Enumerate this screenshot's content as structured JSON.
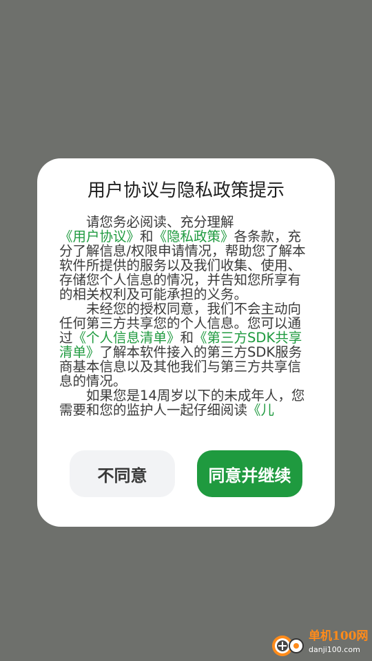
{
  "dialog": {
    "title": "用户协议与隐私政策提示",
    "paragraph1": {
      "pre": "请您务必阅读、充分理解",
      "link_user_agreement": "《用户协议》",
      "and": "和",
      "link_privacy_policy": "《隐私政策》",
      "post": "各条款，充分了解信息/权限申请情况，帮助您了解本软件所提供的服务以及我们收集、使用、存储您个人信息的情况，并告知您所享有的相关权利及可能承担的义务。"
    },
    "paragraph2": {
      "pre": "未经您的授权同意，我们不会主动向任何第三方共享您的个人信息。您可以通过",
      "link_personal_info_list": "《个人信息清单》",
      "and": "和",
      "link_third_party_sdk_list": "《第三方SDK共享清单》",
      "post": "了解本软件接入的第三方SDK服务商基本信息以及其他我们与第三方共享信息的情况。"
    },
    "paragraph3": {
      "pre": "如果您是14周岁以下的未成年人，您需要和您的监护人一起仔细阅读",
      "link_children": "《儿"
    },
    "disagree_label": "不同意",
    "agree_label": "同意并继续"
  },
  "watermark": {
    "name": "单机100网",
    "url": "danji100.com"
  },
  "colors": {
    "backdrop": "#6e706c",
    "accent": "#1f9a3f",
    "secondary_button_bg": "#f2f3f5",
    "watermark_orange": "#ff8b1a"
  }
}
